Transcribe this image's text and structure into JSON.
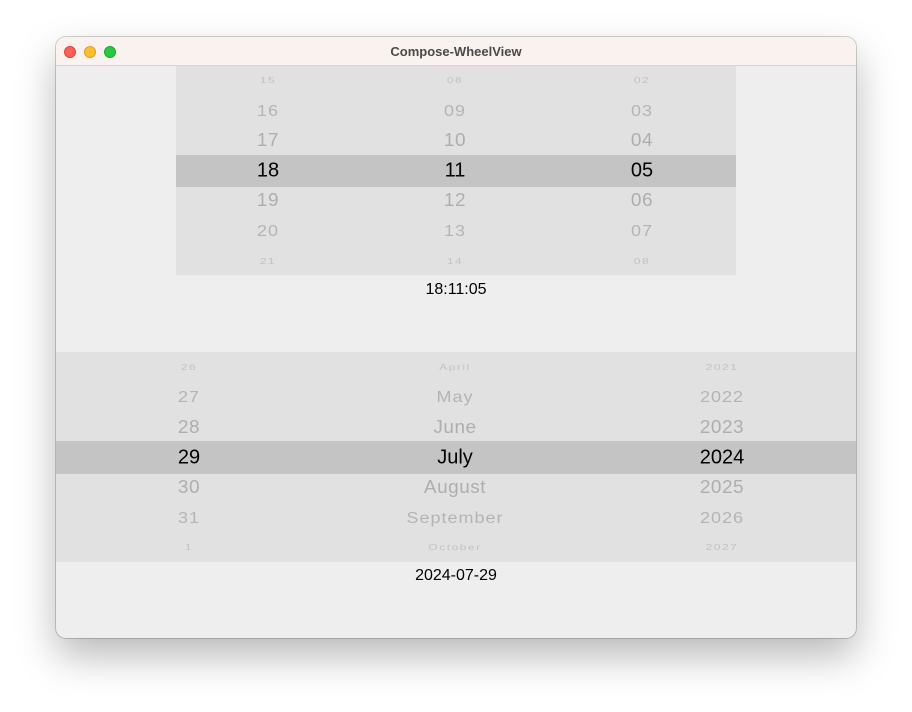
{
  "window": {
    "title": "Compose-WheelView"
  },
  "time_picker": {
    "hours": [
      "15",
      "16",
      "17",
      "18",
      "19",
      "20",
      "21"
    ],
    "minutes": [
      "08",
      "09",
      "10",
      "11",
      "12",
      "13",
      "14"
    ],
    "seconds": [
      "02",
      "03",
      "04",
      "05",
      "06",
      "07",
      "08"
    ],
    "selected_text": "18:11:05"
  },
  "date_picker": {
    "days": [
      "26",
      "27",
      "28",
      "29",
      "30",
      "31",
      "1"
    ],
    "months": [
      "April",
      "May",
      "June",
      "July",
      "August",
      "September",
      "October"
    ],
    "years": [
      "2021",
      "2022",
      "2023",
      "2024",
      "2025",
      "2026",
      "2027"
    ],
    "selected_text": "2024-07-29"
  },
  "colors": {
    "wheel_background": "#e1e1e1",
    "selection_band": "#c4c4c4",
    "window_background": "#eeeeee",
    "titlebar": "#faf2ee"
  }
}
